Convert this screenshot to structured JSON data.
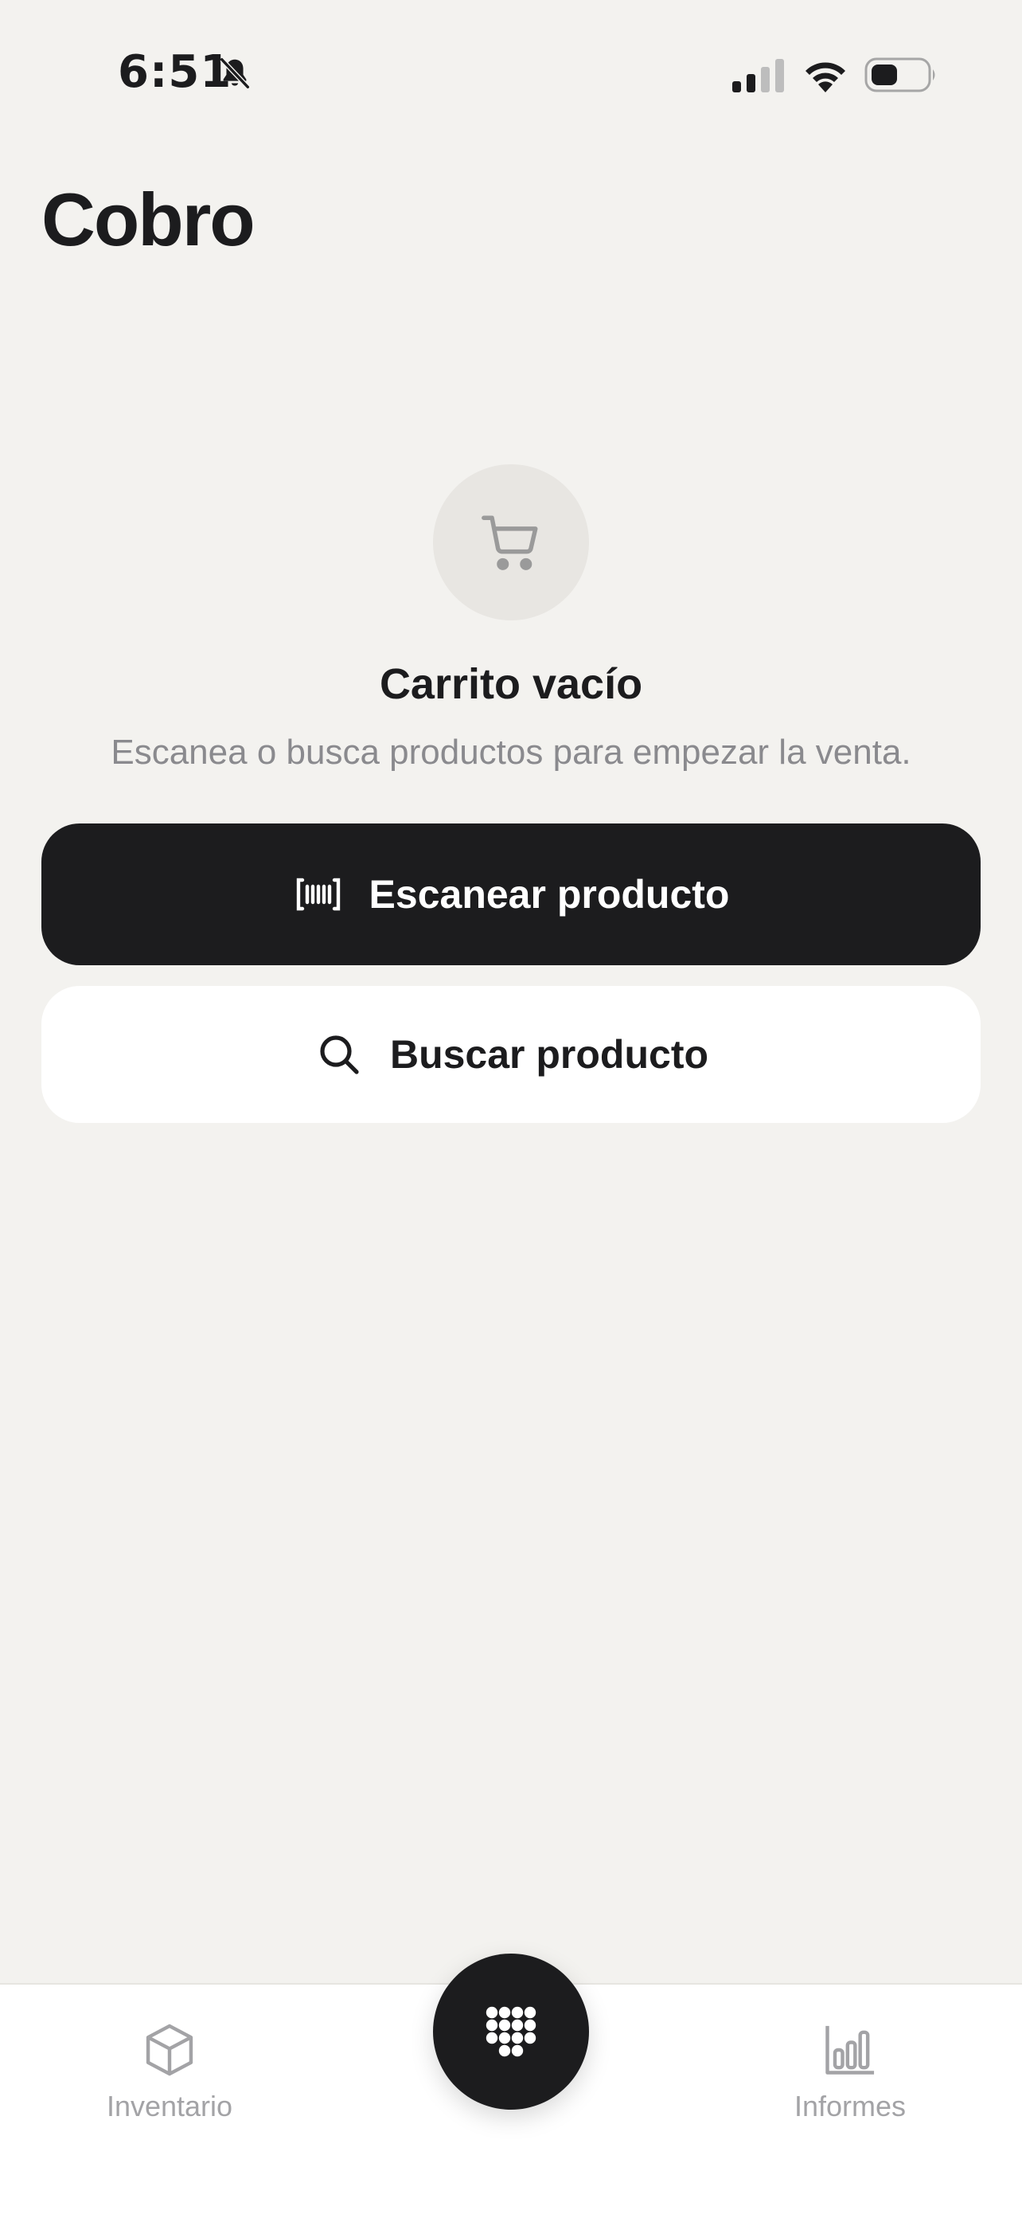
{
  "status_bar": {
    "time": "6:51",
    "icons": [
      "bell-slash-icon",
      "signal-icon",
      "wifi-icon",
      "battery-icon"
    ]
  },
  "header": {
    "title": "Cobro"
  },
  "empty_state": {
    "icon": "shopping-cart-icon",
    "title": "Carrito vacío",
    "subtitle": "Escanea o busca productos para empezar la venta."
  },
  "actions": {
    "scan": {
      "icon": "barcode-icon",
      "label": "Escanear producto"
    },
    "search": {
      "icon": "search-icon",
      "label": "Buscar producto"
    }
  },
  "tab_bar": {
    "items": [
      {
        "icon": "cube-icon",
        "label": "Inventario"
      },
      {
        "icon": "keypad-icon",
        "label": ""
      },
      {
        "icon": "bar-chart-icon",
        "label": "Informes"
      }
    ]
  },
  "colors": {
    "background": "#f3f2ef",
    "primary": "#1c1c1e",
    "muted_text": "#8a8a8e",
    "tab_inactive": "#a3a3a6",
    "cart_circle": "#e8e6e2"
  }
}
